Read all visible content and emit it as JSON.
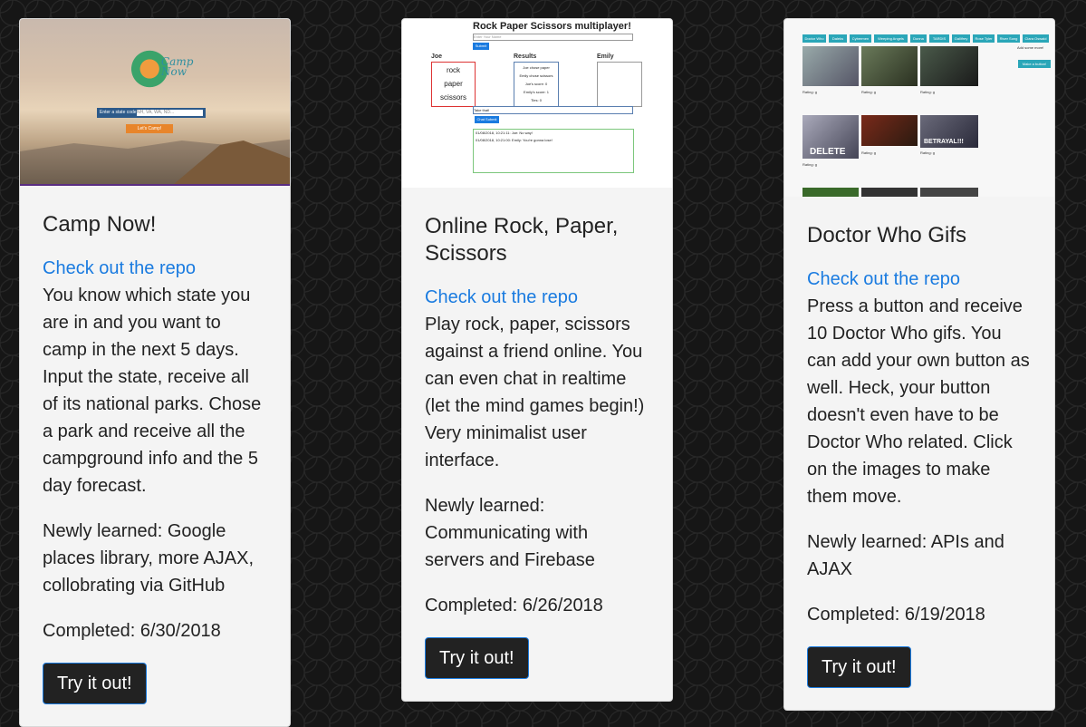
{
  "projects": [
    {
      "title": "Camp Now!",
      "repo_link": "Check out the repo",
      "description": "You know which state you are in and you want to camp in the next 5 days. Input the state, receive all of its national parks. Chose a park and receive all the campground info and the 5 day forecast.",
      "learned": "Newly learned: Google places library, more AJAX, collobrating via GitHub",
      "completed": "Completed: 6/30/2018",
      "button": "Try it out!",
      "thumb": {
        "logo_text_1": "Camp",
        "logo_text_2": "Now",
        "form_label": "Enter a state code:",
        "form_placeholder": "NH, VA, WA, ND...",
        "go_label": "Let's Camp!"
      }
    },
    {
      "title": "Online Rock, Paper, Scissors",
      "repo_link": "Check out the repo",
      "description": "Play rock, paper, scissors against a friend online. You can even chat in realtime (let the mind games begin!) Very minimalist user interface.",
      "learned": "Newly learned: Communicating with servers and Firebase",
      "completed": "Completed: 6/26/2018",
      "button": "Try it out!",
      "thumb": {
        "title": "Rock Paper Scissors multiplayer!",
        "name_placeholder": "Enter Your Name",
        "submit": "Submit",
        "player1": "Joe",
        "results": "Results",
        "player2": "Emily",
        "choices": [
          "rock",
          "paper",
          "scissors"
        ],
        "results_lines": [
          "Joe chose paper",
          "Emily chose scissors",
          "Joe's score: 0",
          "Emily's score: 1",
          "Ties: 0"
        ],
        "chat_input": "Take that!",
        "chat_submit": "Chat Submit",
        "chat_lines": [
          "01/08/2018, 10:21:11: Joe: No way!",
          "01/08/2018, 10:21:00: Emily: You're gonna lose!"
        ]
      }
    },
    {
      "title": "Doctor Who Gifs",
      "repo_link": "Check out the repo",
      "description": "Press a button and receive 10 Doctor Who gifs. You can add your own button as well. Heck, your button doesn't even have to be Doctor Who related. Click on the images to make them move.",
      "learned": "Newly learned: APIs and AJAX",
      "completed": "Completed: 6/19/2018",
      "button": "Try it out!",
      "thumb": {
        "tags": [
          "Doctor Who",
          "Daleks",
          "Cybermen",
          "Weeping Angels",
          "Donna",
          "TARDIS",
          "Gallifrey",
          "Rose Tyler",
          "River Song",
          "Clara Oswald"
        ],
        "add_label": "Add some more!",
        "make_button": "Make a button!",
        "rating": "Rating: g",
        "gif_text_1": "DELETE",
        "gif_text_2": "BETRAYAL!!!"
      }
    }
  ]
}
